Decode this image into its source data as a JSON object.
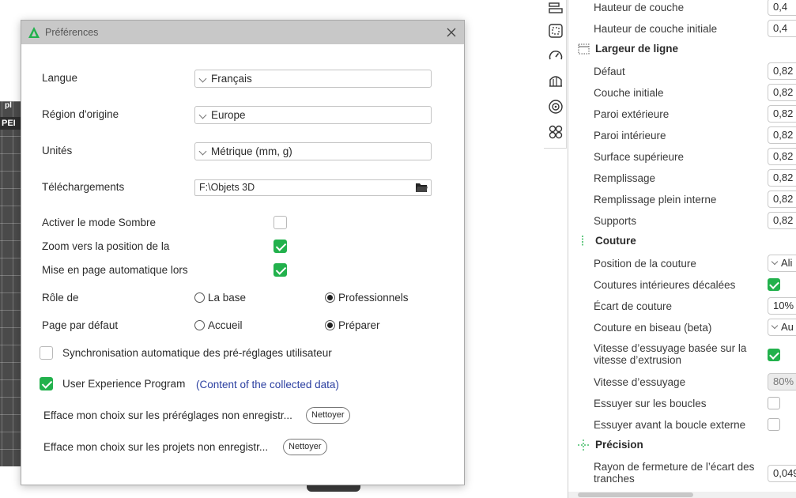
{
  "viewport": {
    "plate_label": "PEI",
    "plate_label_top": "pl"
  },
  "toolbar": {
    "icons": [
      "layers-list-icon",
      "bed-grid-icon",
      "speed-gauge-icon",
      "support-icon",
      "target-icon",
      "pattern-icon"
    ]
  },
  "settings": {
    "rows_top": [
      {
        "label": "Hauteur de couche",
        "value": "0,4"
      },
      {
        "label": "Hauteur de couche initiale",
        "value": "0,4"
      }
    ],
    "section_line_width": "Largeur de ligne",
    "rows_line_width": [
      {
        "label": "Défaut",
        "value": "0,82"
      },
      {
        "label": "Couche initiale",
        "value": "0,82"
      },
      {
        "label": "Paroi extérieure",
        "value": "0,82"
      },
      {
        "label": "Paroi intérieure",
        "value": "0,82"
      },
      {
        "label": "Surface supérieure",
        "value": "0,82"
      },
      {
        "label": "Remplissage",
        "value": "0,82"
      },
      {
        "label": "Remplissage plein interne",
        "value": "0,82"
      },
      {
        "label": "Supports",
        "value": "0,82"
      }
    ],
    "section_seam": "Couture",
    "seam_position_label": "Position de la couture",
    "seam_position_value": "Ali",
    "staggered_seams_label": "Coutures intérieures décalées",
    "seam_gap_label": "Écart de couture",
    "seam_gap_value": "10%",
    "scarf_seam_label": "Couture en biseau (beta)",
    "scarf_seam_value": "Au",
    "wipe_speed_extrusion_label": "Vitesse d’essuyage basée sur la vitesse d’extrusion",
    "wipe_speed_label": "Vitesse d’essuyage",
    "wipe_speed_value": "80%",
    "wipe_loops_label": "Essuyer sur les boucles",
    "wipe_before_external_label": "Essuyer avant la boucle externe",
    "section_precision": "Précision",
    "slice_closing_label": "Rayon de fermeture de l’écart des tranches",
    "slice_closing_value": "0,049"
  },
  "dialog": {
    "title": "Préférences",
    "language_label": "Langue",
    "language_value": "Français",
    "region_label": "Région d'origine",
    "region_value": "Europe",
    "units_label": "Unités",
    "units_value": "Métrique (mm, g)",
    "downloads_label": "Téléchargements",
    "downloads_value": "F:\\Objets 3D",
    "dark_mode_label": "Activer le mode Sombre",
    "zoom_label": "Zoom vers la position de la",
    "auto_layout_label": "Mise en page automatique lors",
    "role_label": "Rôle de",
    "role_basic": "La base",
    "role_pro": "Professionnels",
    "default_page_label": "Page par défaut",
    "page_home": "Accueil",
    "page_prepare": "Préparer",
    "sync_label": "Synchronisation automatique des pré-réglages utilisateur",
    "uxp_label": "User Experience Program",
    "uxp_link": "(Content of the collected data)",
    "clear_presets_label": "Efface mon choix sur les préréglages non enregistr...",
    "clear_projects_label": "Efface mon choix sur les projets non enregistr...",
    "clear_button": "Nettoyer"
  },
  "state": {
    "dark_mode": false,
    "zoom": true,
    "auto_layout": true,
    "role": "pro",
    "default_page": "prepare",
    "sync": false,
    "uxp": true,
    "staggered_seams": true,
    "wipe_speed_extrusion": true,
    "wipe_loops": false,
    "wipe_before_external": false
  },
  "colors": {
    "accent_green": "#22b14c",
    "link_blue": "#2b3fa0",
    "titlebar": "#c8c8c8"
  }
}
